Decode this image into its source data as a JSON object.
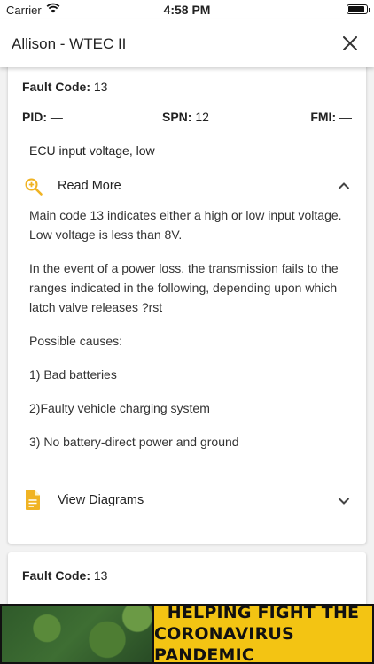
{
  "status_bar": {
    "carrier": "Carrier",
    "time": "4:58 PM"
  },
  "header": {
    "title": "Allison - WTEC II"
  },
  "cards": [
    {
      "fault_label": "Fault Code:",
      "fault_code": "13",
      "pid_label": "PID:",
      "pid_value": "—",
      "spn_label": "SPN:",
      "spn_value": "12",
      "fmi_label": "FMI:",
      "fmi_value": "—",
      "description": "ECU input voltage, low",
      "read_more_label": "Read More",
      "body": [
        "Main code 13 indicates either a high or low input voltage. Low voltage is less than 8V.",
        "In the event of a power loss, the transmission fails to the ranges indicated in the following, depending upon which latch valve releases ?rst",
        "Possible causes:",
        "1) Bad batteries",
        "2)Faulty vehicle charging system",
        "3) No battery-direct power and ground"
      ],
      "view_diagrams_label": "View Diagrams"
    },
    {
      "fault_label": "Fault Code:",
      "fault_code": "13"
    }
  ],
  "ad": {
    "line1": "HELPING FIGHT THE",
    "line2": "CORONAVIRUS PANDEMIC"
  },
  "colors": {
    "accent": "#f0b323",
    "text": "#222222"
  }
}
